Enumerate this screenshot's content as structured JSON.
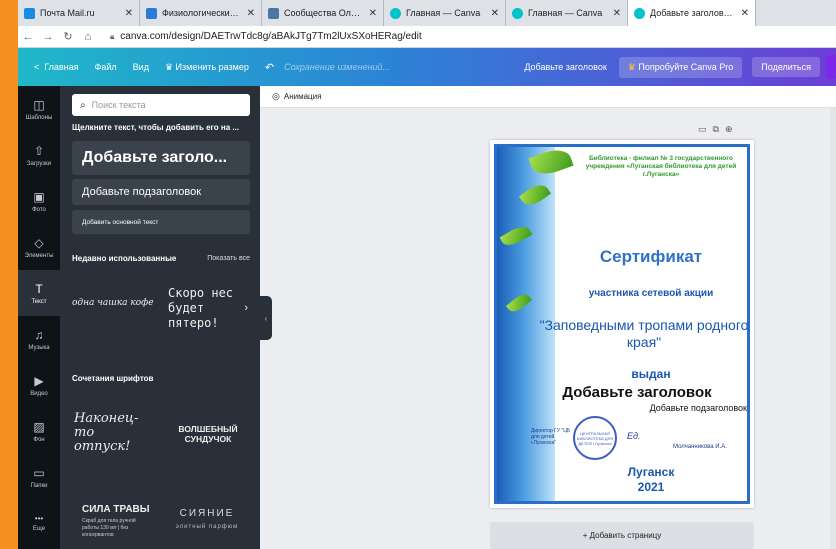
{
  "tabs": [
    {
      "title": "Почта Mail.ru",
      "color": "#168de2"
    },
    {
      "title": "Физиологические последст",
      "color": "#2a7bd6"
    },
    {
      "title": "Сообщества Олеси Ершово",
      "color": "#4a76a8"
    },
    {
      "title": "Главная — Canva",
      "color": "#00c4cc"
    },
    {
      "title": "Главная — Canva",
      "color": "#00c4cc"
    },
    {
      "title": "Добавьте заголовок — Пла",
      "color": "#00c4cc"
    }
  ],
  "address": {
    "url": "canva.com/design/DAETrwTdc8g/aBAkJTg7Tm2lUxSXoHERag/edit"
  },
  "header": {
    "home": "Главная",
    "file": "Файл",
    "view": "Вид",
    "resize": "Изменить размер",
    "saving": "Сохранение изменений...",
    "doc_title": "Добавьте заголовок",
    "pro": "Попробуйте Canva Pro",
    "share": "Поделиться"
  },
  "rail": [
    {
      "label": "Шаблоны",
      "icon": "templates-icon",
      "glyph": "◫"
    },
    {
      "label": "Загрузки",
      "icon": "upload-icon",
      "glyph": "⇧"
    },
    {
      "label": "Фото",
      "icon": "photo-icon",
      "glyph": "▣"
    },
    {
      "label": "Элементы",
      "icon": "elements-icon",
      "glyph": "◇"
    },
    {
      "label": "Текст",
      "icon": "text-icon",
      "glyph": "T"
    },
    {
      "label": "Музыка",
      "icon": "music-icon",
      "glyph": "♫"
    },
    {
      "label": "Видео",
      "icon": "video-icon",
      "glyph": "▶"
    },
    {
      "label": "Фон",
      "icon": "background-icon",
      "glyph": "▨"
    },
    {
      "label": "Папки",
      "icon": "folder-icon",
      "glyph": "▭"
    },
    {
      "label": "Еще",
      "icon": "more-icon",
      "glyph": "•••"
    }
  ],
  "panel": {
    "search_placeholder": "Поиск текста",
    "hint": "Щелкните текст, чтобы добавить его на ...",
    "heading": "Добавьте заголо...",
    "subheading": "Добавьте подзаголовок",
    "body": "Добавить основной текст",
    "recent": "Недавно использованные",
    "show_all": "Показать все",
    "recent_1": "одна чашка кофе",
    "recent_2": "Скоро нес будет пятеро!",
    "combos": "Сочетания шрифтов",
    "combo_1": "Наконец-то отпуск!",
    "combo_2": "ВОЛШЕБНЫЙ СУНДУЧОК",
    "combo_3": "СИЛА ТРАВЫ",
    "combo_3_sub": "Скраб для тела ручной работы 130 мл | без консервантов",
    "combo_4": "СИЯНИЕ",
    "combo_4_sub": "элитный парфюм"
  },
  "workspace": {
    "animation": "Анимация",
    "add_page": "+ Добавить страницу"
  },
  "certificate": {
    "library": "Библиотека - филиал № 3 государственного учреждения «Луганская библиотека для детей г.Луганска»",
    "title": "Сертификат",
    "participant": "участника сетевой акции",
    "action": "\"Заповедными тропами родного края\"",
    "given": "выдан",
    "heading": "Добавьте заголовок",
    "subheading": "Добавьте подзаголовок",
    "stamp": "ЦЕНТРАЛЬНАЯ БИБЛИОТЕКА ДЛЯ ДЕТЕЙ г.Луганска",
    "director": "Директор ГУ \"ЦБ для детей г.Луганска\"",
    "signature": "Ед.",
    "name": "Молчанникова И.А.",
    "city": "Луганск",
    "year": "2021"
  }
}
